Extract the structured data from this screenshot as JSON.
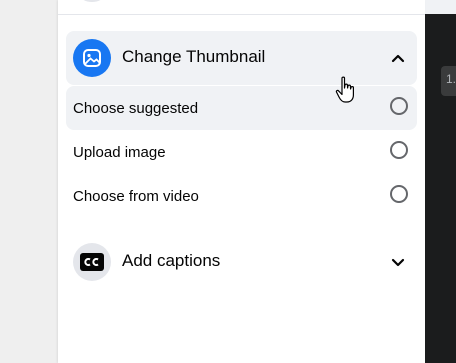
{
  "thumbnail_section": {
    "title": "Change Thumbnail",
    "icon": "image-icon",
    "expanded": true,
    "accent_color": "#1877f2",
    "options": [
      {
        "label": "Choose suggested",
        "selected": false
      },
      {
        "label": "Upload image",
        "selected": false
      },
      {
        "label": "Choose from video",
        "selected": false
      }
    ]
  },
  "captions_section": {
    "title": "Add captions",
    "icon": "cc-icon",
    "expanded": false
  },
  "video_overlay": {
    "chip_text": "1."
  }
}
